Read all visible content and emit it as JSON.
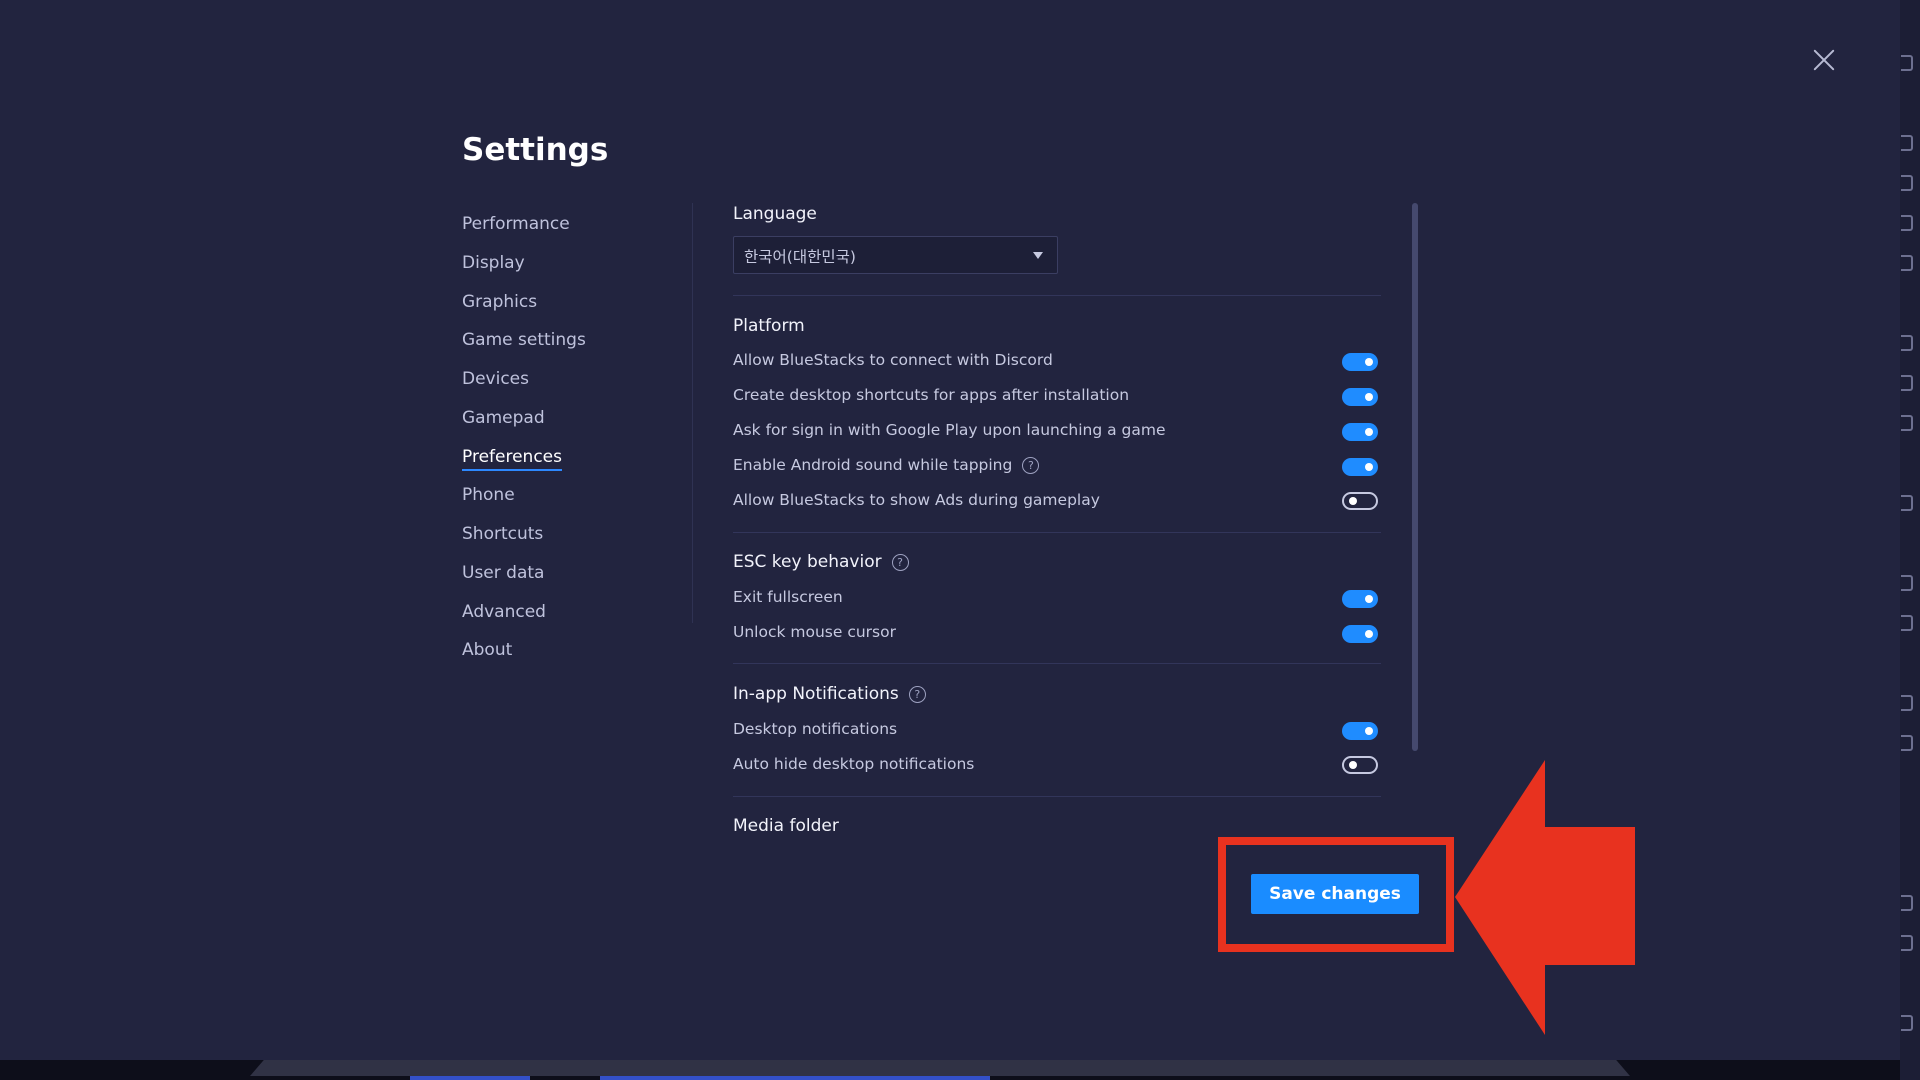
{
  "dialog": {
    "title": "Settings",
    "close_icon": "close-icon"
  },
  "sidebar": {
    "items": [
      {
        "label": "Performance"
      },
      {
        "label": "Display"
      },
      {
        "label": "Graphics"
      },
      {
        "label": "Game settings"
      },
      {
        "label": "Devices"
      },
      {
        "label": "Gamepad"
      },
      {
        "label": "Preferences",
        "active": true
      },
      {
        "label": "Phone"
      },
      {
        "label": "Shortcuts"
      },
      {
        "label": "User data"
      },
      {
        "label": "Advanced"
      },
      {
        "label": "About"
      }
    ]
  },
  "language": {
    "title": "Language",
    "selected": "한국어(대한민국)"
  },
  "platform": {
    "title": "Platform",
    "options": [
      {
        "label": "Allow BlueStacks to connect with Discord",
        "enabled": true
      },
      {
        "label": "Create desktop shortcuts for apps after installation",
        "enabled": true
      },
      {
        "label": "Ask for sign in with Google Play upon launching a game",
        "enabled": true
      },
      {
        "label": "Enable Android sound while tapping",
        "enabled": true,
        "help": true
      },
      {
        "label": "Allow BlueStacks to show Ads during gameplay",
        "enabled": false
      }
    ]
  },
  "esc_key": {
    "title": "ESC key behavior",
    "options": [
      {
        "label": "Exit fullscreen",
        "enabled": true
      },
      {
        "label": "Unlock mouse cursor",
        "enabled": true
      }
    ]
  },
  "notifications": {
    "title": "In-app Notifications",
    "options": [
      {
        "label": "Desktop notifications",
        "enabled": true
      },
      {
        "label": "Auto hide desktop notifications",
        "enabled": false
      }
    ]
  },
  "media_folder": {
    "title": "Media folder"
  },
  "footer": {
    "save_label": "Save changes"
  },
  "help_glyph": "?",
  "colors": {
    "background": "#22243f",
    "accent": "#1a8cff",
    "annotation_red": "#e8321f"
  }
}
